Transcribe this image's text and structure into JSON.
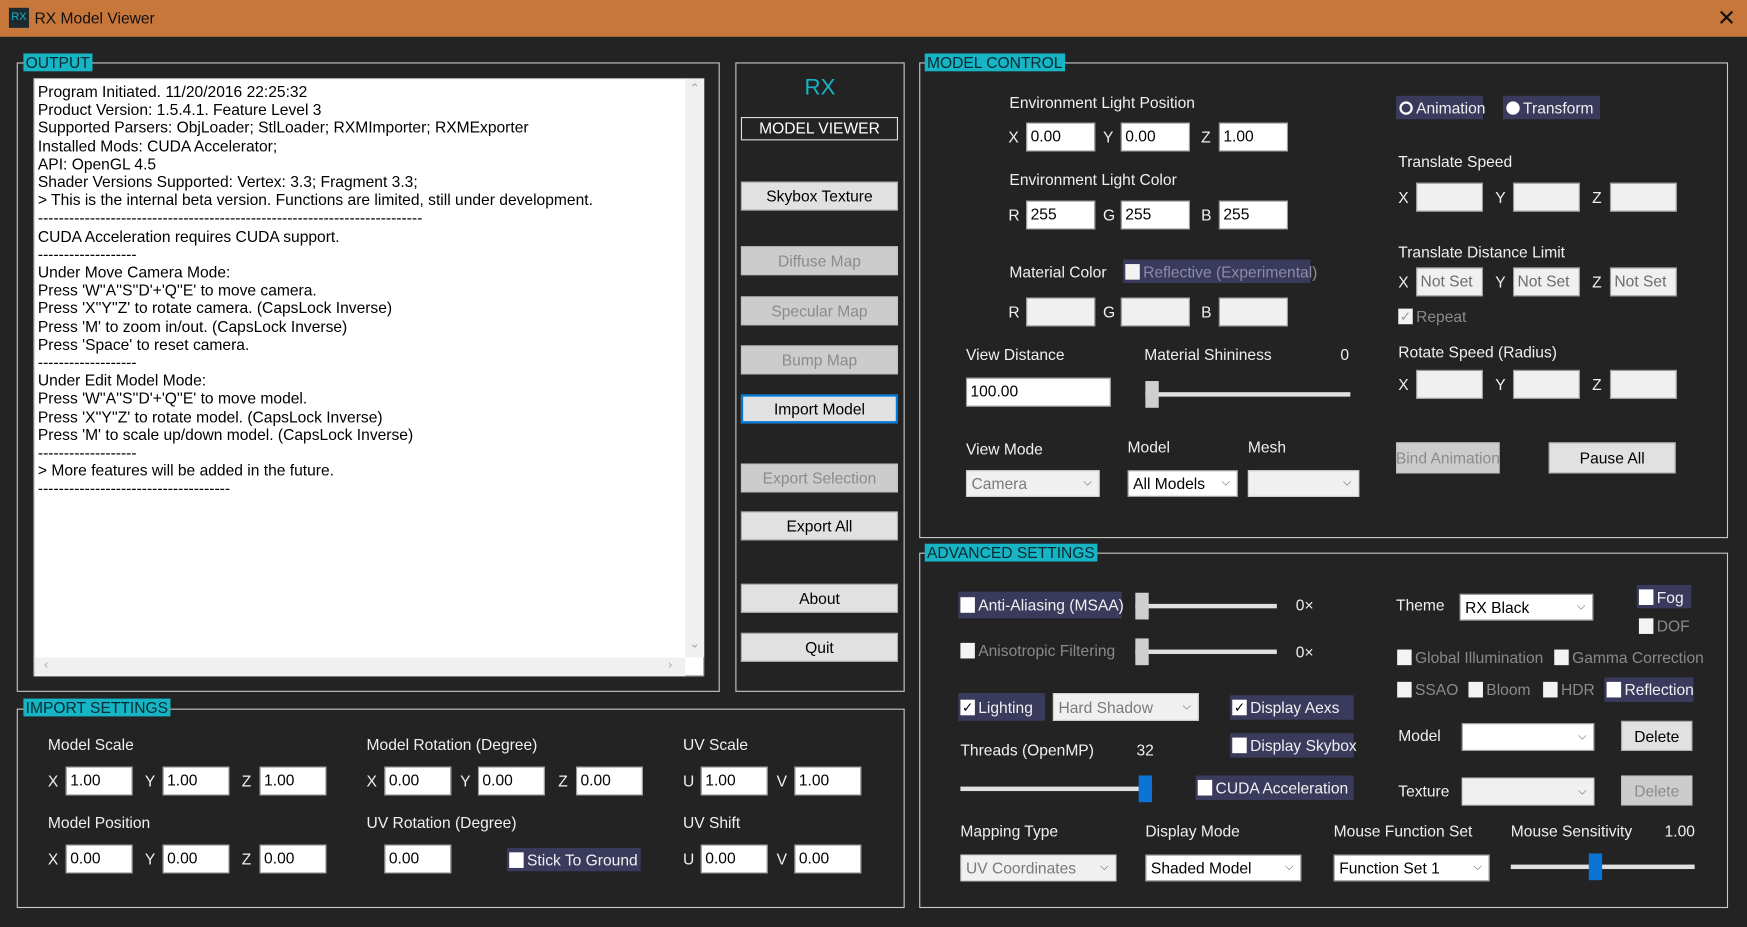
{
  "window": {
    "title": "RX Model Viewer",
    "logo": "RX",
    "close_icon": "close-icon",
    "accent": "#16b4c4",
    "titlebar_color": "#c8773a"
  },
  "output": {
    "label": "OUTPUT",
    "lines": [
      "Program Initiated. 11/20/2016 22:25:32",
      "Product Version: 1.5.4.1. Feature Level 3",
      "Supported Parsers: ObjLoader; StlLoader; RXMImporter; RXMExporter",
      "Installed Mods: CUDA Accelerator;",
      "API: OpenGL 4.5",
      "Shader Versions Supported: Vertex: 3.3; Fragment 3.3;",
      "> This is the internal beta version. Functions are limited, still under development.",
      "--------------------------------------------------------------------------",
      "CUDA Acceleration requires CUDA support.",
      "-------------------",
      "Under Move Camera Mode:",
      "Press 'W''A''S''D'+'Q''E' to move camera.",
      "Press 'X''Y''Z' to rotate camera. (CapsLock Inverse)",
      "Press 'M' to zoom in/out. (CapsLock Inverse)",
      "Press 'Space' to reset camera.",
      "-------------------",
      "Under Edit Model Mode:",
      "Press 'W''A''S''D'+'Q''E' to move model.",
      "Press 'X''Y''Z' to rotate model. (CapsLock Inverse)",
      "Press 'M' to scale up/down model. (CapsLock Inverse)",
      "-------------------",
      "> More features will be added in the future.",
      "-------------------------------------"
    ]
  },
  "menu": {
    "brand": "RX",
    "subtitle": "MODEL VIEWER",
    "buttons": {
      "skybox": "Skybox Texture",
      "diffuse": "Diffuse Map",
      "specular": "Specular Map",
      "bump": "Bump Map",
      "import": "Import Model",
      "export_selection": "Export Selection",
      "export_all": "Export All",
      "about": "About",
      "quit": "Quit"
    }
  },
  "import_settings": {
    "label": "IMPORT SETTINGS",
    "model_scale": {
      "label": "Model Scale",
      "x": "1.00",
      "y": "1.00",
      "z": "1.00"
    },
    "model_rotation": {
      "label": "Model Rotation (Degree)",
      "x": "0.00",
      "y": "0.00",
      "z": "0.00"
    },
    "uv_scale": {
      "label": "UV Scale",
      "u": "1.00",
      "v": "1.00"
    },
    "model_position": {
      "label": "Model Position",
      "x": "0.00",
      "y": "0.00",
      "z": "0.00"
    },
    "uv_rotation": {
      "label": "UV Rotation (Degree)",
      "value": "0.00"
    },
    "stick_to_ground": {
      "label": "Stick To Ground",
      "checked": false
    },
    "uv_shift": {
      "label": "UV Shift",
      "u": "0.00",
      "v": "0.00"
    },
    "axis": {
      "x": "X",
      "y": "Y",
      "z": "Z",
      "u": "U",
      "v": "V",
      "r": "R",
      "g": "G",
      "b": "B"
    }
  },
  "model_control": {
    "label": "MODEL CONTROL",
    "env_light_position": {
      "label": "Environment Light Position",
      "x": "0.00",
      "y": "0.00",
      "z": "1.00"
    },
    "env_light_color": {
      "label": "Environment Light Color",
      "r": "255",
      "g": "255",
      "b": "255"
    },
    "material_color": {
      "label": "Material Color",
      "reflective": "Reflective (Experimental)"
    },
    "view_distance": {
      "label": "View Distance",
      "value": "100.00"
    },
    "material_shininess": {
      "label": "Material Shininess",
      "value": "0"
    },
    "view_mode": {
      "label": "View Mode",
      "selected": "Camera"
    },
    "model": {
      "label": "Model",
      "selected": "All Models"
    },
    "mesh": {
      "label": "Mesh",
      "selected": ""
    },
    "mode_radio": {
      "animation": "Animation",
      "transform": "Transform",
      "selected": "Transform"
    },
    "translate_speed": {
      "label": "Translate Speed"
    },
    "translate_distance_limit": {
      "label": "Translate Distance Limit",
      "x": "Not Set",
      "y": "Not Set",
      "z": "Not Set"
    },
    "repeat": {
      "label": "Repeat",
      "checked": true
    },
    "rotate_speed": {
      "label": "Rotate Speed (Radius)"
    },
    "bind_animation": "Bind Animation",
    "pause_all": "Pause All"
  },
  "advanced": {
    "label": "ADVANCED SETTINGS",
    "anti_aliasing": {
      "label": "Anti-Aliasing (MSAA)",
      "value": "0×",
      "checked": false
    },
    "anisotropic": {
      "label": "Anisotropic Filtering",
      "value": "0×",
      "checked": false
    },
    "lighting": {
      "label": "Lighting",
      "checked": true,
      "shadow": "Hard Shadow"
    },
    "display_axes": {
      "label": "Display Aexs",
      "checked": true
    },
    "display_skybox": {
      "label": "Display Skybox",
      "checked": false
    },
    "cuda": {
      "label": "CUDA Acceleration",
      "checked": false
    },
    "threads": {
      "label": "Threads (OpenMP)",
      "value": "32"
    },
    "theme": {
      "label": "Theme",
      "selected": "RX Black"
    },
    "fog": "Fog",
    "dof": "DOF",
    "global_illumination": "Global Illumination",
    "gamma_correction": "Gamma Correction",
    "ssao": "SSAO",
    "bloom": "Bloom",
    "hdr": "HDR",
    "reflection": "Reflection",
    "model": {
      "label": "Model",
      "selected": "",
      "delete": "Delete"
    },
    "texture": {
      "label": "Texture",
      "selected": "",
      "delete": "Delete"
    },
    "mapping_type": {
      "label": "Mapping Type",
      "selected": "UV Coordinates"
    },
    "display_mode": {
      "label": "Display Mode",
      "selected": "Shaded Model"
    },
    "mouse_function_set": {
      "label": "Mouse Function Set",
      "selected": "Function Set 1"
    },
    "mouse_sensitivity": {
      "label": "Mouse Sensitivity",
      "value": "1.00"
    }
  }
}
